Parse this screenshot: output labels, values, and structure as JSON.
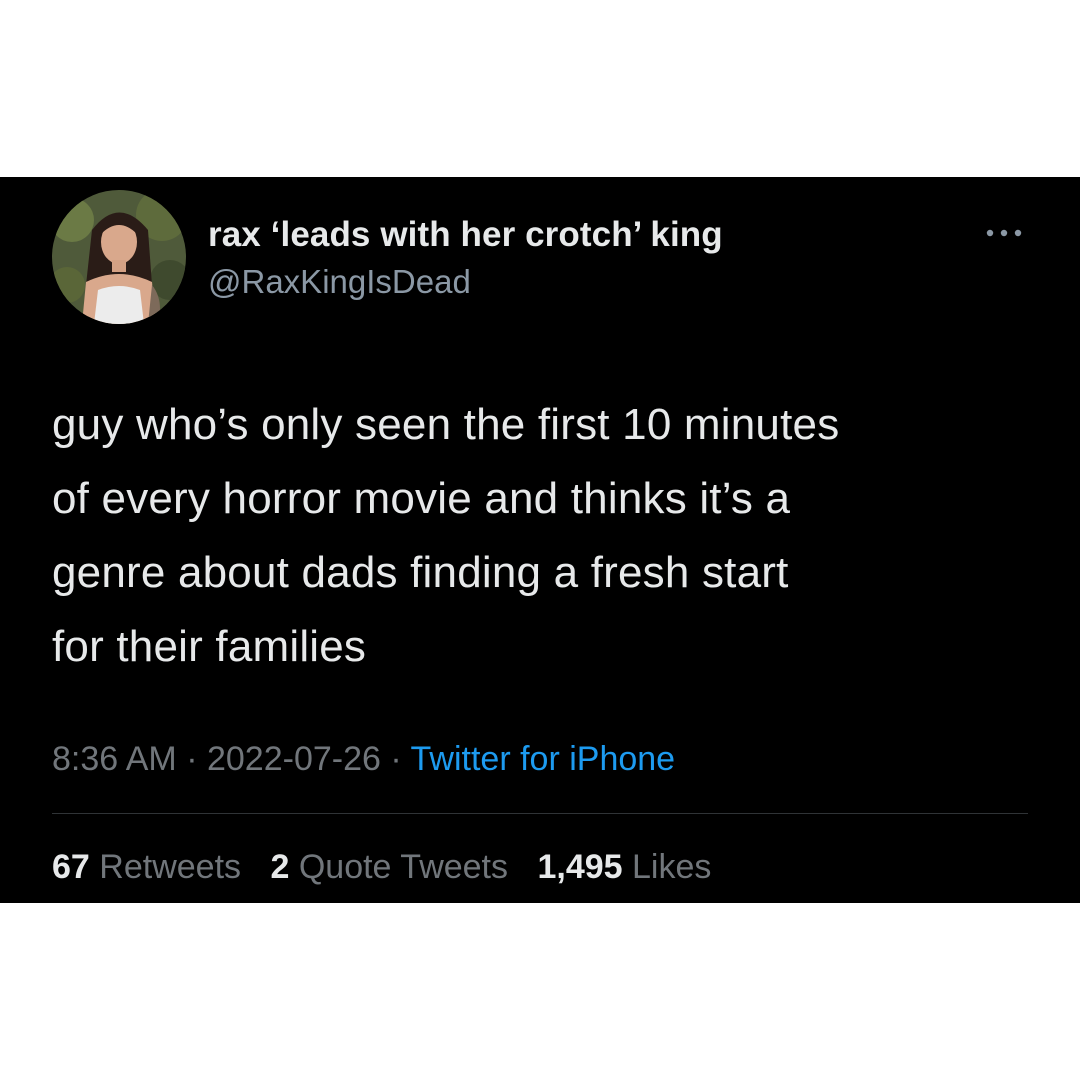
{
  "tweet": {
    "author": {
      "display_name": "rax ‘leads with her crotch’ king",
      "handle": "@RaxKingIsDead",
      "avatar_icon": "profile-photo"
    },
    "more_icon": "more-horizontal-icon",
    "text": "guy who’s only seen the first 10 minutes\nof every horror movie and thinks it’s a\ngenre about dads finding a fresh start\nfor their families",
    "time": "8:36 AM",
    "separator": "·",
    "date": "2022-07-26",
    "source": "Twitter for iPhone",
    "stats": {
      "retweets_count": "67",
      "retweets_label": "Retweets",
      "quotes_count": "2",
      "quotes_label": "Quote Tweets",
      "likes_count": "1,495",
      "likes_label": "Likes"
    }
  },
  "colors": {
    "background": "#000000",
    "frame": "#ffffff",
    "text_primary": "#e7e9ea",
    "text_secondary": "#71767b",
    "link": "#1d9bf0",
    "divider": "#2f3336"
  }
}
